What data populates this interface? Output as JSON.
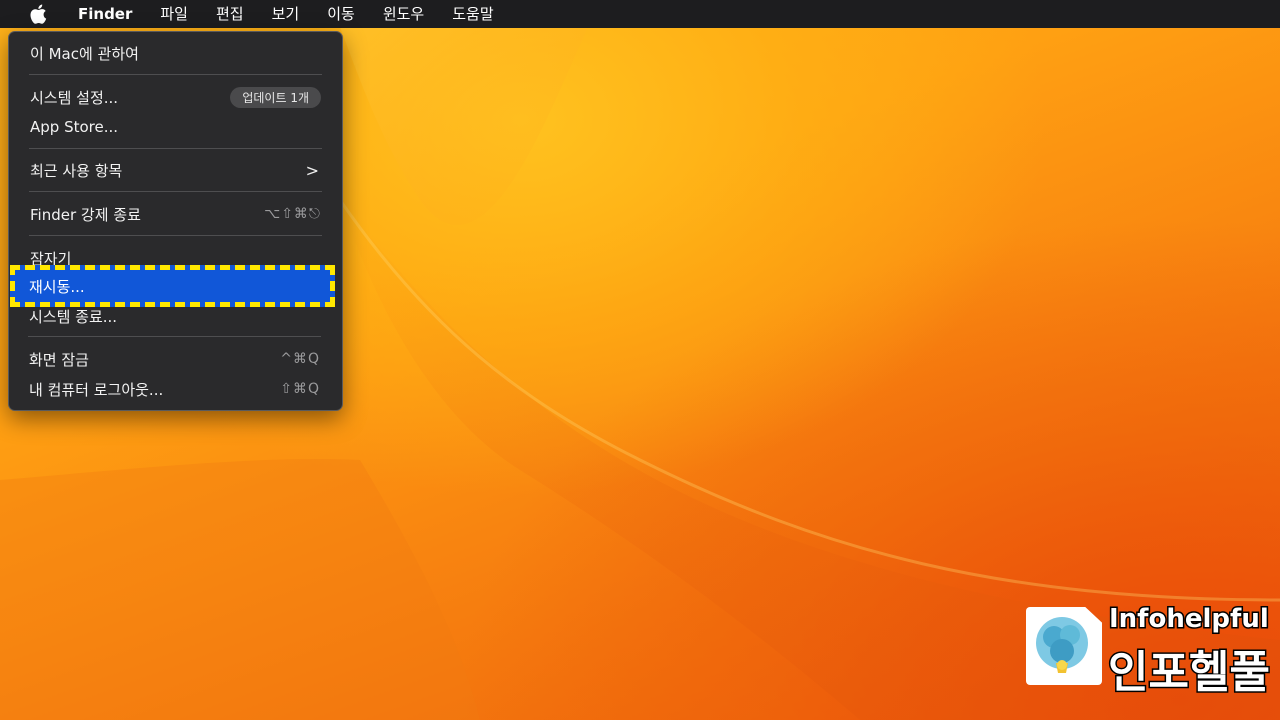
{
  "menubar": {
    "apple_icon": "apple-logo-icon",
    "app_name": "Finder",
    "items": [
      "파일",
      "편집",
      "보기",
      "이동",
      "윈도우",
      "도움말"
    ]
  },
  "apple_menu": {
    "about": "이 Mac에 관하여",
    "system_settings": "시스템 설정...",
    "update_badge": "업데이트 1개",
    "app_store": "App Store...",
    "recent_items": "최근 사용 항목",
    "recent_chevron": ">",
    "force_quit": "Finder 강제 종료",
    "force_quit_shortcut": "⌥⇧⌘⎋",
    "sleep": "잠자기",
    "restart": "재시동...",
    "shutdown": "시스템 종료...",
    "lock_screen": "화면 잠금",
    "lock_shortcut": "^⌘Q",
    "logout": "내 컴퓨터 로그아웃...",
    "logout_shortcut": "⇧⌘Q"
  },
  "watermark": {
    "name_en": "Infohelpful",
    "name_ko": "인포헬풀"
  },
  "colors": {
    "menubar_bg": "#1d1d1f",
    "menu_bg": "#2a2a2c",
    "highlight": "#1157d8",
    "annotation_border": "#ffe800"
  }
}
